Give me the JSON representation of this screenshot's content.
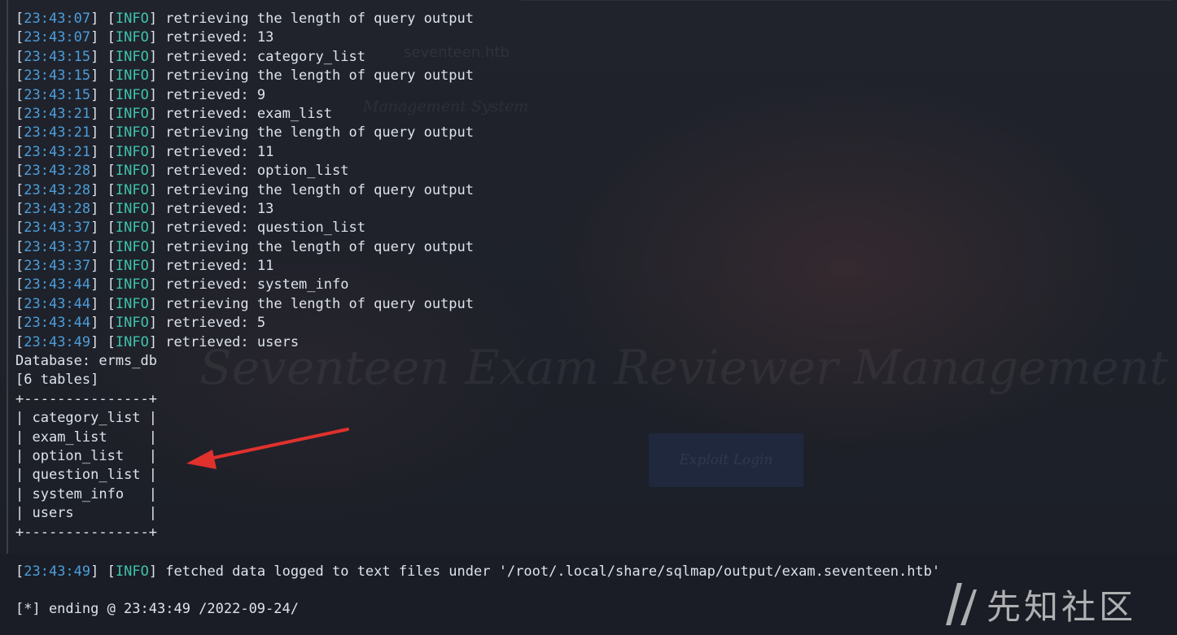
{
  "background": {
    "title": "Seventeen Exam Reviewer Management Sys",
    "subtitle": "Management System",
    "host": "seventeen.htb",
    "button": "Exploit Login"
  },
  "terminal": {
    "log": [
      {
        "time": "23:43:07",
        "level": "INFO",
        "msg": "retrieving the length of query output"
      },
      {
        "time": "23:43:07",
        "level": "INFO",
        "msg": "retrieved: 13"
      },
      {
        "time": "23:43:15",
        "level": "INFO",
        "msg": "retrieved: category_list"
      },
      {
        "time": "23:43:15",
        "level": "INFO",
        "msg": "retrieving the length of query output"
      },
      {
        "time": "23:43:15",
        "level": "INFO",
        "msg": "retrieved: 9"
      },
      {
        "time": "23:43:21",
        "level": "INFO",
        "msg": "retrieved: exam_list"
      },
      {
        "time": "23:43:21",
        "level": "INFO",
        "msg": "retrieving the length of query output"
      },
      {
        "time": "23:43:21",
        "level": "INFO",
        "msg": "retrieved: 11"
      },
      {
        "time": "23:43:28",
        "level": "INFO",
        "msg": "retrieved: option_list"
      },
      {
        "time": "23:43:28",
        "level": "INFO",
        "msg": "retrieving the length of query output"
      },
      {
        "time": "23:43:28",
        "level": "INFO",
        "msg": "retrieved: 13"
      },
      {
        "time": "23:43:37",
        "level": "INFO",
        "msg": "retrieved: question_list"
      },
      {
        "time": "23:43:37",
        "level": "INFO",
        "msg": "retrieving the length of query output"
      },
      {
        "time": "23:43:37",
        "level": "INFO",
        "msg": "retrieved: 11"
      },
      {
        "time": "23:43:44",
        "level": "INFO",
        "msg": "retrieved: system_info"
      },
      {
        "time": "23:43:44",
        "level": "INFO",
        "msg": "retrieving the length of query output"
      },
      {
        "time": "23:43:44",
        "level": "INFO",
        "msg": "retrieved: 5"
      },
      {
        "time": "23:43:49",
        "level": "INFO",
        "msg": "retrieved: users"
      }
    ],
    "database": "Database: erms_db",
    "table_count": "[6 tables]",
    "table_border": "+---------------+",
    "tables": [
      "category_list",
      "exam_list",
      "option_list",
      "question_list",
      "system_info",
      "users"
    ],
    "footer": {
      "time": "23:43:49",
      "level": "INFO",
      "msg": "fetched data logged to text files under '/root/.local/share/sqlmap/output/exam.seventeen.htb'"
    },
    "ending": "[*] ending @ 23:43:49 /2022-09-24/"
  },
  "watermark": {
    "text": "先知社区"
  },
  "colors": {
    "timestamp": "#4b9edc",
    "level": "#3ec3ac",
    "text": "#dde3ec",
    "arrow": "#e0312d"
  },
  "icons": {
    "annotation": "red-arrow-icon",
    "watermark": "xianzhi-logo-icon"
  }
}
